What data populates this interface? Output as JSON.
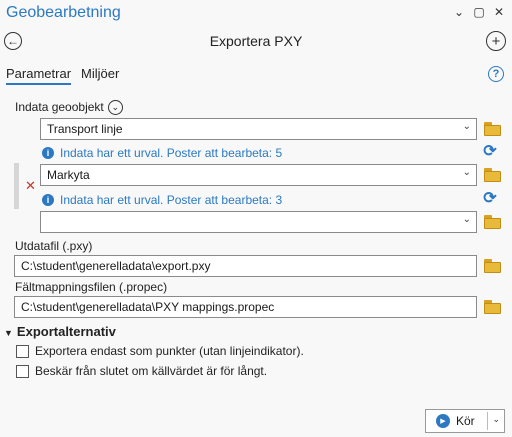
{
  "pane": {
    "title": "Geobearbetning"
  },
  "tool": {
    "title": "Exportera PXY"
  },
  "tabs": [
    {
      "label": "Parametrar",
      "active": true
    },
    {
      "label": "Miljöer",
      "active": false
    }
  ],
  "indata": {
    "label": "Indata geoobjekt",
    "rows": [
      {
        "value": "Transport linje",
        "info": "Indata har ett urval. Poster att bearbeta: 5"
      },
      {
        "value": "Markyta",
        "info": "Indata har ett urval. Poster att bearbeta: 3"
      },
      {
        "value": ""
      }
    ]
  },
  "output": {
    "label": "Utdatafil (.pxy)",
    "value": "C:\\student\\generelladata\\export.pxy"
  },
  "mapping": {
    "label": "Fältmappningsfilen (.propec)",
    "value": "C:\\student\\generelladata\\PXY mappings.propec"
  },
  "export_options": {
    "title": "Exportalternativ",
    "options": [
      {
        "label": "Exportera endast som punkter (utan linjeindikator).",
        "checked": false
      },
      {
        "label": "Beskär från slutet om källvärdet är för långt.",
        "checked": false
      }
    ]
  },
  "run": {
    "label": "Kör"
  },
  "colors": {
    "accent": "#2b79c2",
    "folder": "#e9b93a",
    "remove": "#c0392b"
  }
}
